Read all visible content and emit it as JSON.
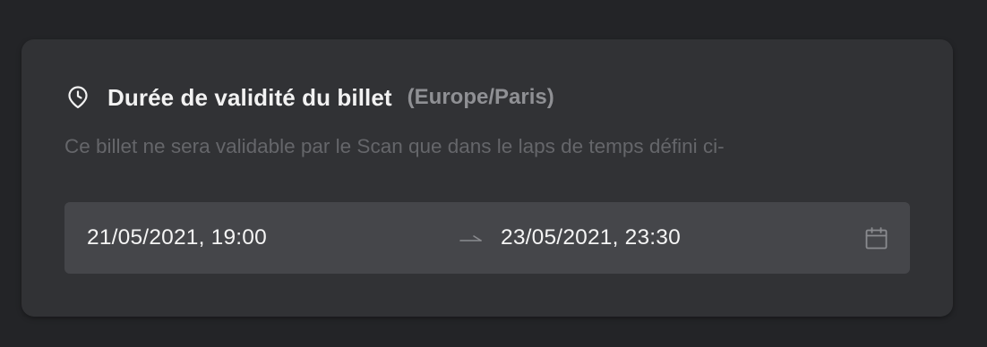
{
  "card": {
    "title": "Durée de validité du billet",
    "timezone": "(Europe/Paris)",
    "description": "Ce billet ne sera validable par le Scan que dans le laps de temps défini ci-"
  },
  "range": {
    "start": "21/05/2021, 19:00",
    "end": "23/05/2021, 23:30"
  },
  "icons": {
    "header": "clock-icon",
    "separator": "arrow-right-icon",
    "picker": "calendar-icon"
  },
  "colors": {
    "background": "#232427",
    "card": "#313235",
    "input": "#45464a",
    "title": "#f2f2f2",
    "muted": "#8f9094",
    "description": "#65666a"
  }
}
